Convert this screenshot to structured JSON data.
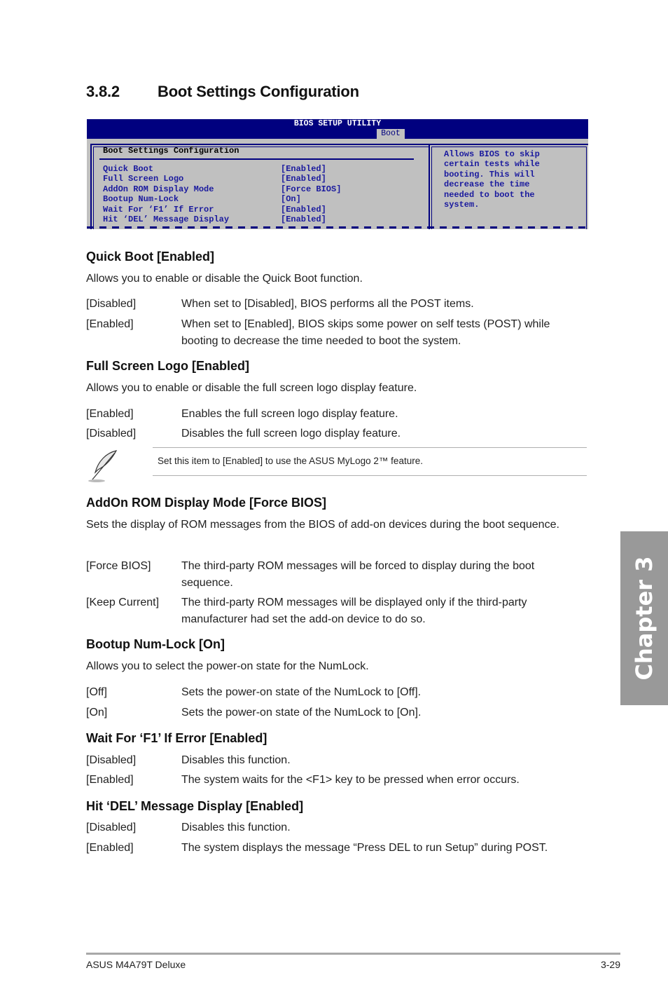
{
  "section": {
    "number": "3.8.2",
    "title": "Boot Settings Configuration"
  },
  "bios": {
    "title": "BIOS SETUP UTILITY",
    "active_tab": "Boot",
    "panel_heading": "Boot Settings Configuration",
    "items": [
      {
        "label": "Quick Boot",
        "value": "[Enabled]"
      },
      {
        "label": "Full Screen Logo",
        "value": "[Enabled]"
      },
      {
        "label": "AddOn ROM Display Mode",
        "value": "[Force BIOS]"
      },
      {
        "label": "Bootup Num-Lock",
        "value": "[On]"
      },
      {
        "label": "Wait For ‘F1’ If Error",
        "value": "[Enabled]"
      },
      {
        "label": "Hit ‘DEL’ Message Display",
        "value": "[Enabled]"
      }
    ],
    "help_text": "Allows BIOS to skip\ncertain tests while\nbooting. This will\ndecrease the time\nneeded to boot the\nsystem."
  },
  "sections": {
    "quick_boot": {
      "heading": "Quick Boot [Enabled]",
      "desc": "Allows you to enable or disable the Quick Boot function.",
      "options": [
        {
          "key": "[Disabled]",
          "text": "When set to [Disabled], BIOS performs all the POST items."
        },
        {
          "key": "[Enabled]",
          "text": "When set to [Enabled], BIOS skips some power on self tests (POST) while booting to decrease the time needed to boot the system."
        }
      ]
    },
    "full_screen_logo": {
      "heading": "Full Screen Logo [Enabled]",
      "desc": "Allows you to enable or disable the full screen logo display feature.",
      "options": [
        {
          "key": "[Enabled]",
          "text": "Enables the full screen logo display feature."
        },
        {
          "key": "[Disabled]",
          "text": "Disables the full screen logo display feature."
        }
      ],
      "note": "Set this item to [Enabled] to use the ASUS MyLogo 2™ feature."
    },
    "addon_rom": {
      "heading": "AddOn ROM Display Mode [Force BIOS]",
      "desc": "Sets the display of ROM messages from the BIOS of add-on devices during the boot sequence.",
      "options": [
        {
          "key": "[Force BIOS]",
          "text": "The third-party ROM messages will be forced to display during the boot sequence."
        },
        {
          "key": "[Keep Current]",
          "text": "The third-party ROM messages will be displayed only if the third-party manufacturer had set the add-on device to do so."
        }
      ]
    },
    "numlock": {
      "heading": "Bootup Num-Lock [On]",
      "desc": "Allows you to select the power-on state for the NumLock.",
      "options": [
        {
          "key": "[Off]",
          "text": "Sets the power-on state of the NumLock to [Off]."
        },
        {
          "key": "[On]",
          "text": "Sets the power-on state of the NumLock to [On]."
        }
      ]
    },
    "wait_f1": {
      "heading": "Wait For ‘F1’ If Error [Enabled]",
      "options": [
        {
          "key": "[Disabled]",
          "text": "Disables this function."
        },
        {
          "key": "[Enabled]",
          "text": "The system waits for the <F1> key to be pressed when error occurs."
        }
      ]
    },
    "hit_del": {
      "heading": "Hit ‘DEL’ Message Display [Enabled]",
      "options": [
        {
          "key": "[Disabled]",
          "text": "Disables this function."
        },
        {
          "key": "[Enabled]",
          "text": "The system displays the message “Press DEL to run Setup” during POST."
        }
      ]
    }
  },
  "chapter_tab": "Chapter 3",
  "footer": {
    "left": "ASUS M4A79T Deluxe",
    "right": "3-29"
  },
  "icons": {
    "note": "feather-pen-icon"
  }
}
